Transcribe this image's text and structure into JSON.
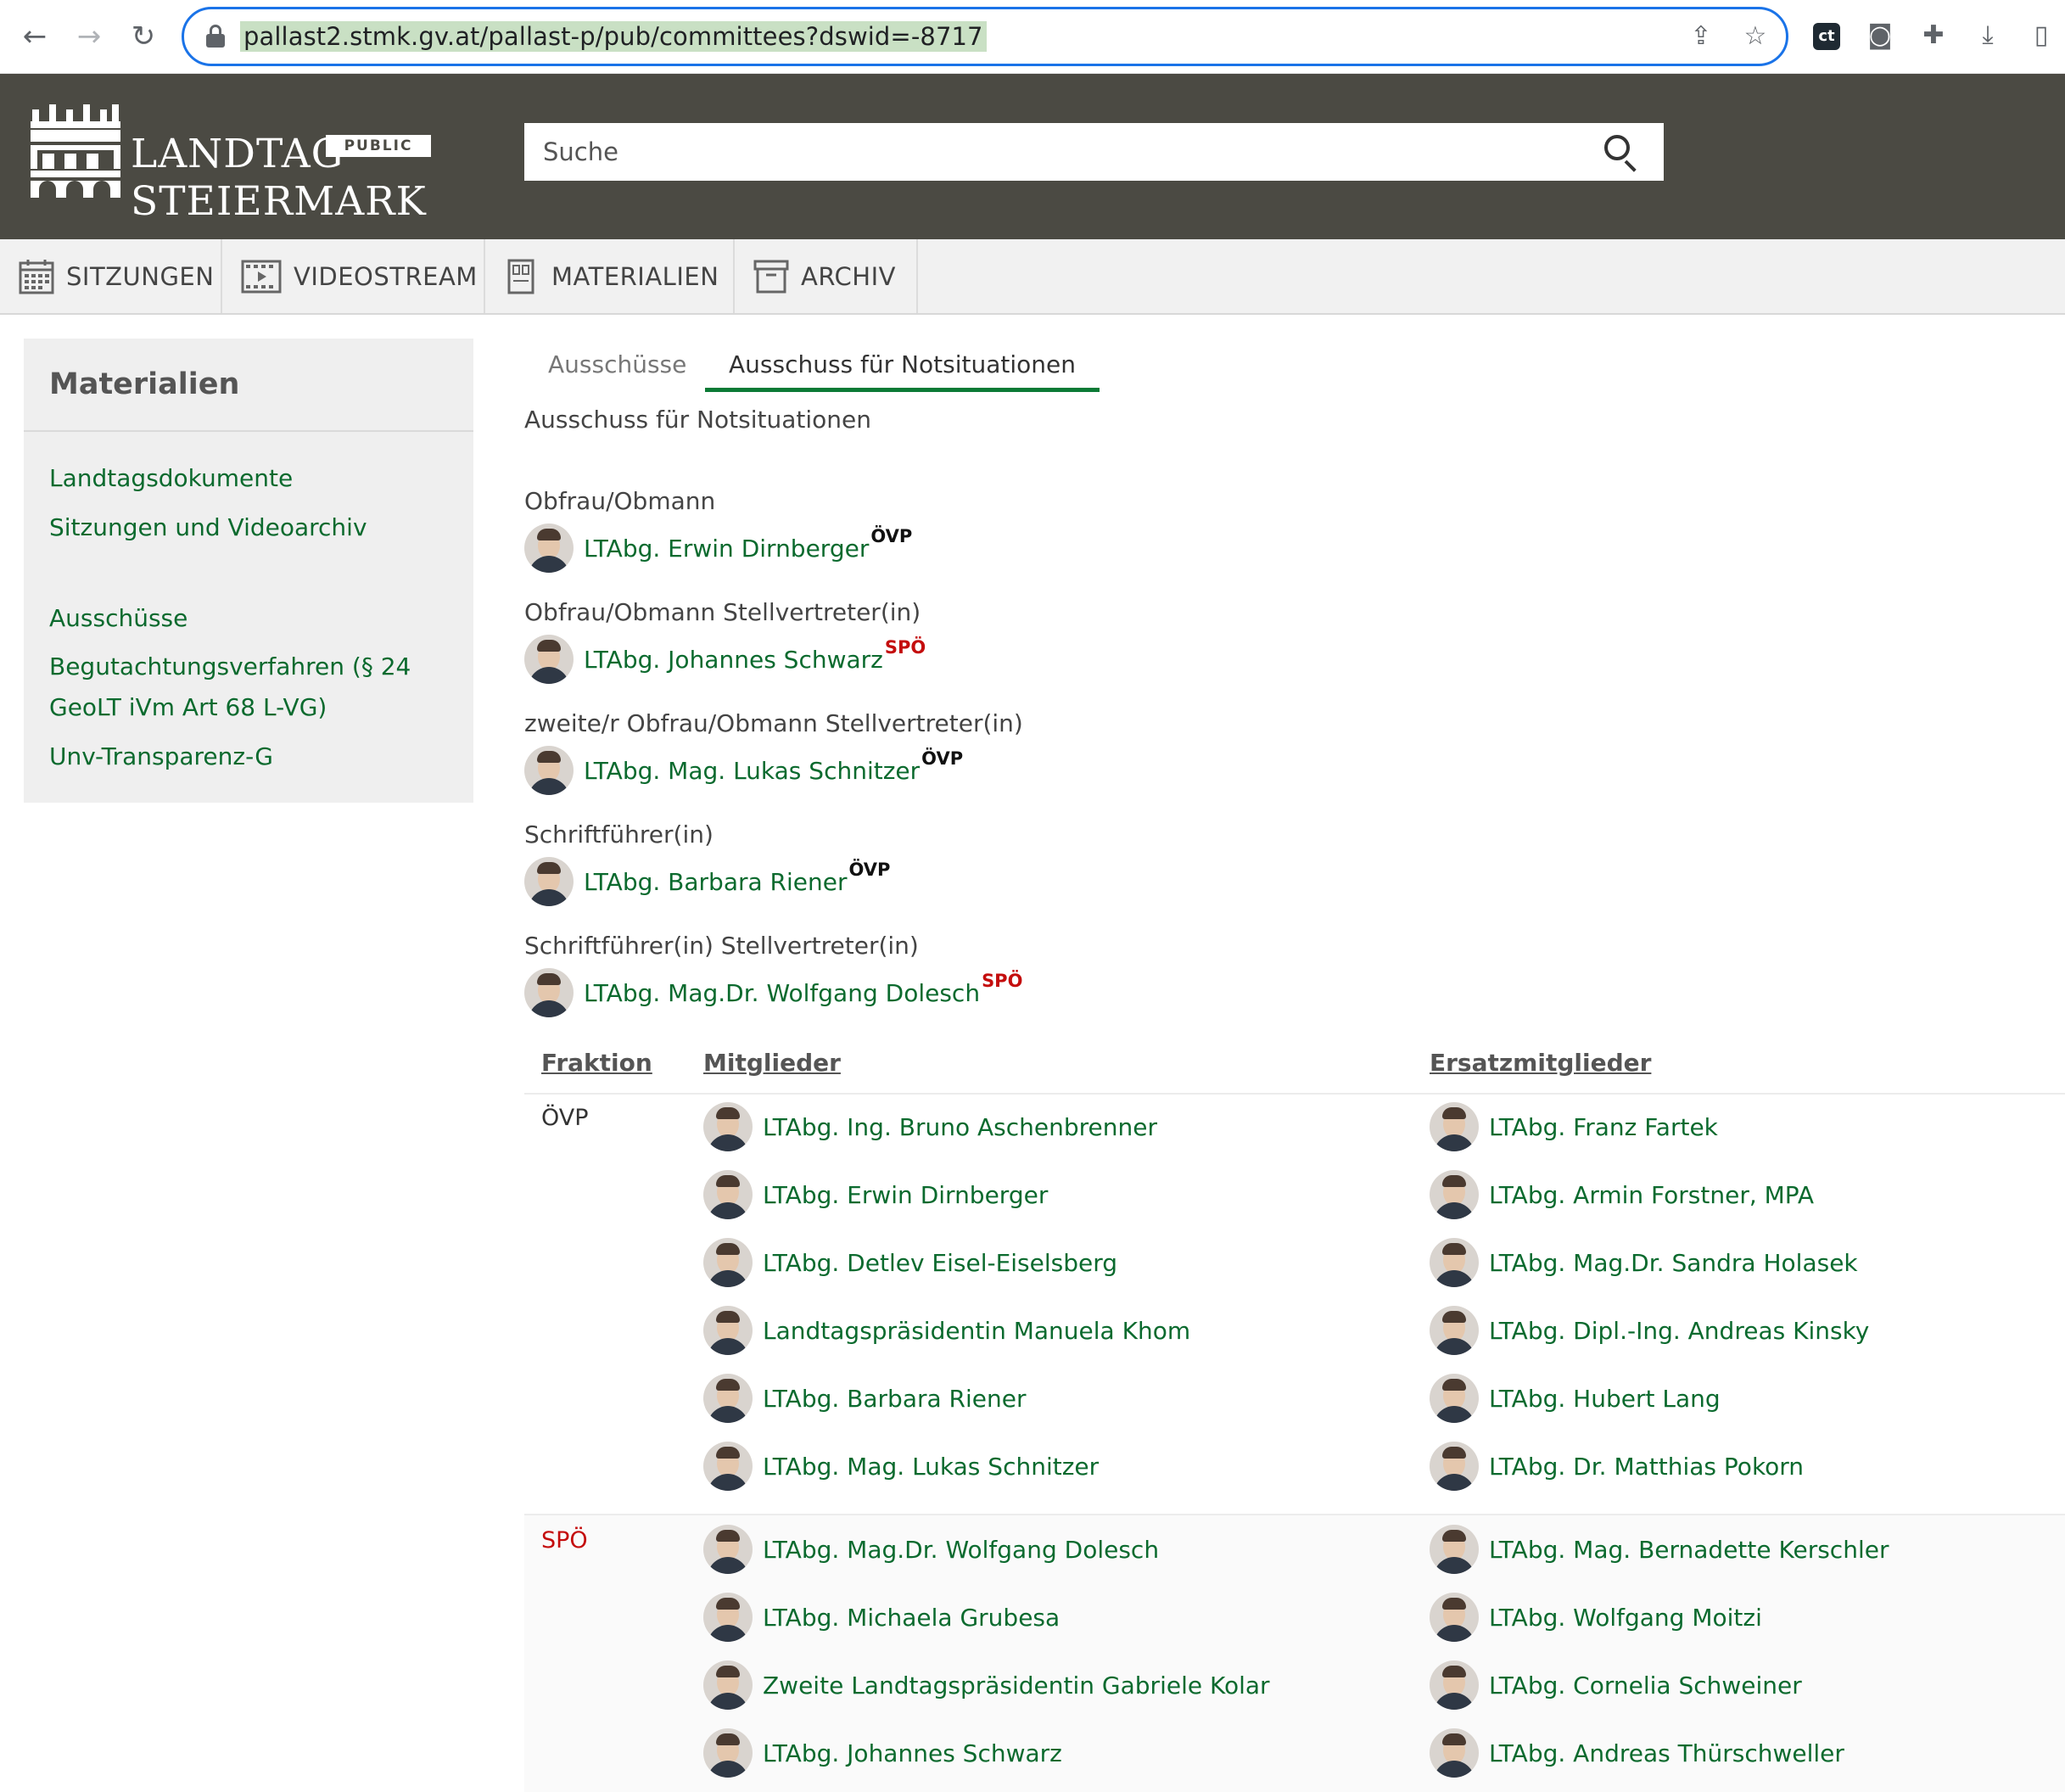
{
  "browser": {
    "url": "pallast2.stmk.gv.at/pallast-p/pub/committees?dswid=-8717"
  },
  "header": {
    "logo_line1": "LANDTAG",
    "logo_line2": "STEIERMARK",
    "badge": "PUBLIC",
    "search_placeholder": "Suche"
  },
  "nav": {
    "items": [
      {
        "label": "SITZUNGEN",
        "icon": "calendar-icon"
      },
      {
        "label": "VIDEOSTREAM",
        "icon": "film-icon"
      },
      {
        "label": "MATERIALIEN",
        "icon": "documents-icon"
      },
      {
        "label": "ARCHIV",
        "icon": "archive-box-icon"
      }
    ]
  },
  "sidebar": {
    "title": "Materialien",
    "links": [
      "Landtagsdokumente",
      "Sitzungen und Videoarchiv",
      "Ausschüsse",
      "Begutachtungsverfahren (§ 24",
      "GeoLT iVm Art 68 L-VG)",
      "Unv-Transparenz-G"
    ]
  },
  "tabs": [
    "Ausschüsse",
    "Ausschuss für Notsituationen"
  ],
  "committee_title": "Ausschuss für Notsituationen",
  "roles": [
    {
      "role": "Obfrau/Obmann",
      "name": "LTAbg. Erwin Dirnberger",
      "party": "ÖVP"
    },
    {
      "role": "Obfrau/Obmann Stellvertreter(in)",
      "name": "LTAbg. Johannes Schwarz",
      "party": "SPÖ"
    },
    {
      "role": "zweite/r Obfrau/Obmann Stellvertreter(in)",
      "name": "LTAbg. Mag. Lukas Schnitzer",
      "party": "ÖVP"
    },
    {
      "role": "Schriftführer(in)",
      "name": "LTAbg. Barbara Riener",
      "party": "ÖVP"
    },
    {
      "role": "Schriftführer(in) Stellvertreter(in)",
      "name": "LTAbg. Mag.Dr. Wolfgang Dolesch",
      "party": "SPÖ"
    }
  ],
  "table": {
    "headers": [
      "Fraktion",
      "Mitglieder",
      "Ersatzmitglieder"
    ],
    "groups": [
      {
        "fraktion": "ÖVP",
        "members": [
          "LTAbg. Ing. Bruno Aschenbrenner",
          "LTAbg. Erwin Dirnberger",
          "LTAbg. Detlev Eisel-Eiselsberg",
          "Landtagspräsidentin Manuela Khom",
          "LTAbg. Barbara Riener",
          "LTAbg. Mag. Lukas Schnitzer"
        ],
        "substitutes": [
          "LTAbg. Franz Fartek",
          "LTAbg. Armin Forstner, MPA",
          "LTAbg. Mag.Dr. Sandra Holasek",
          "LTAbg. Dipl.-Ing. Andreas Kinsky",
          "LTAbg. Hubert Lang",
          "LTAbg. Dr. Matthias Pokorn"
        ]
      },
      {
        "fraktion": "SPÖ",
        "members": [
          "LTAbg. Mag.Dr. Wolfgang Dolesch",
          "LTAbg. Michaela Grubesa",
          "Zweite Landtagspräsidentin Gabriele Kolar",
          "LTAbg. Johannes Schwarz"
        ],
        "substitutes": [
          "LTAbg. Mag. Bernadette Kerschler",
          "LTAbg. Wolfgang Moitzi",
          "LTAbg. Cornelia Schweiner",
          "LTAbg. Andreas Thürschweller"
        ]
      }
    ]
  },
  "colors": {
    "header_bg": "#4b4a43",
    "link_green": "#0b6a2e",
    "tab_underline": "#0b7a36",
    "spo_red": "#c40d0d"
  }
}
